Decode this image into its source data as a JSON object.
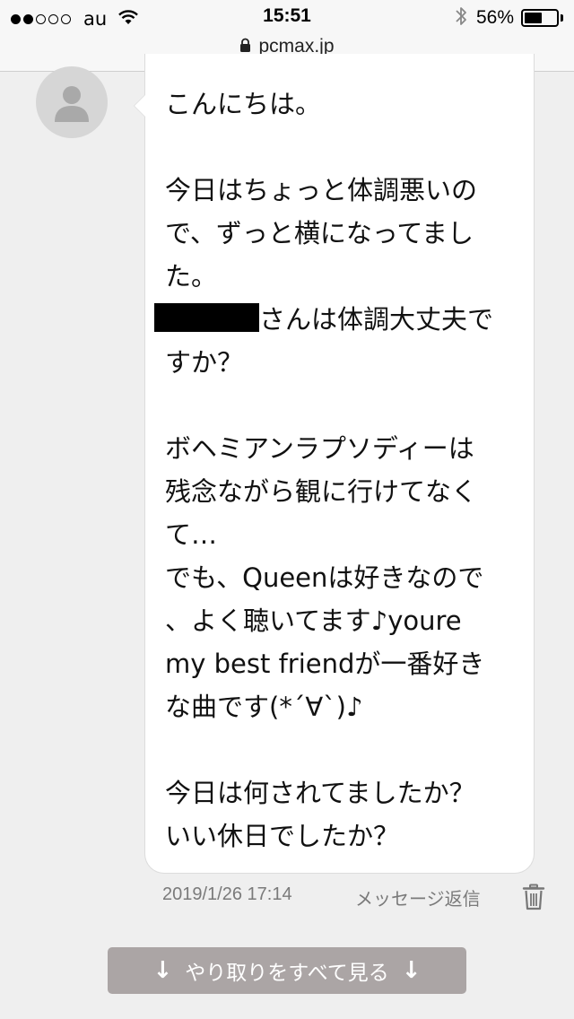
{
  "status_bar": {
    "carrier": "au",
    "time": "15:51",
    "battery_percent": "56%",
    "battery_level": 0.56,
    "signal_bars_filled": 2,
    "signal_bars_total": 5
  },
  "browser": {
    "url": "pcmax.jp"
  },
  "message": {
    "lines": [
      "こんにちは。",
      "今日はちょっと体調悪いの",
      "で、ずっと横になってまし",
      "た。",
      "さんは体調大丈夫で",
      "すか？",
      "ボヘミアンラプソディーは",
      "残念ながら観に行けてなく",
      "て…",
      "でも、Queenは好きなので",
      "、よく聴いてます♪youre",
      "my best friendが一番好き",
      "な曲です(*´∀`)♪",
      "今日は何されてましたか？",
      "いい休日でしたか？"
    ],
    "timestamp": "2019/1/26 17:14",
    "reply_label": "メッセージ返信"
  },
  "view_all": {
    "label": "やり取りをすべて見る",
    "arrow": "↓"
  },
  "colors": {
    "background": "#efefef",
    "bubble": "#ffffff",
    "button": "#aba5a5",
    "meta_text": "#7a7a7a"
  }
}
